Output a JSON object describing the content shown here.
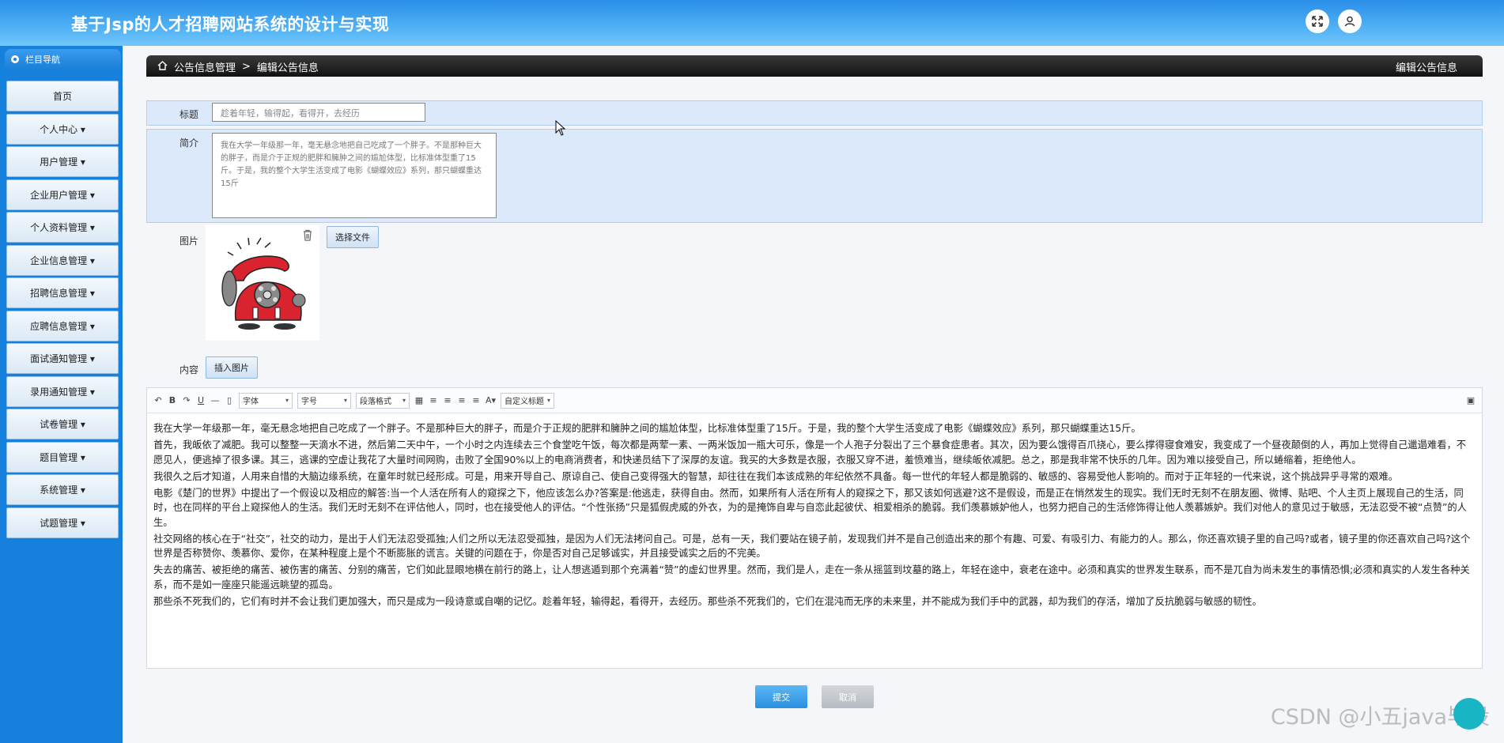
{
  "app": {
    "title": "基于Jsp的人才招聘网站系统的设计与实现"
  },
  "sidebar": {
    "header": "栏目导航",
    "items": [
      {
        "label": "首页"
      },
      {
        "label": "个人中心 ▾"
      },
      {
        "label": "用户管理 ▾"
      },
      {
        "label": "企业用户管理 ▾"
      },
      {
        "label": "个人资料管理 ▾"
      },
      {
        "label": "企业信息管理 ▾"
      },
      {
        "label": "招聘信息管理 ▾"
      },
      {
        "label": "应聘信息管理 ▾"
      },
      {
        "label": "面试通知管理 ▾"
      },
      {
        "label": "录用通知管理 ▾"
      },
      {
        "label": "试卷管理 ▾"
      },
      {
        "label": "题目管理 ▾"
      },
      {
        "label": "系统管理 ▾"
      },
      {
        "label": "试题管理 ▾"
      }
    ]
  },
  "breadcrumb": {
    "root": "公告信息管理",
    "sep": ">",
    "current": "编辑公告信息",
    "right_title": "编辑公告信息"
  },
  "form": {
    "title_label": "标题",
    "title_value": "趁着年轻，输得起，看得开，去经历",
    "intro_label": "简介",
    "intro_value": "我在大学一年级那一年，毫无悬念地把自己吃成了一个胖子。不是那种巨大的胖子，而是介于正规的肥胖和臃肿之间的尴尬体型，比标准体型重了15斤。于是，我的整个大学生活变成了电影《蝴蝶效应》系列，那只蝴蝶重达15斤",
    "image_label": "图片",
    "choose_file": "选择文件",
    "content_label": "内容",
    "insert_image": "插入图片"
  },
  "editor_toolbar": {
    "font": "字体",
    "size": "字号",
    "paragraph": "段落格式",
    "custom_title": "自定义标题"
  },
  "content": {
    "paragraphs": [
      "我在大学一年级那一年，毫无悬念地把自己吃成了一个胖子。不是那种巨大的胖子，而是介于正规的肥胖和臃肿之间的尴尬体型，比标准体型重了15斤。于是，我的整个大学生活变成了电影《蝴蝶效应》系列，那只蝴蝶重达15斤。",
      "首先，我皈依了减肥。我可以整整一天滴水不进，然后第二天中午，一个小时之内连续去三个食堂吃午饭，每次都是两荤一素、一两米饭加一瓶大可乐，像是一个人孢子分裂出了三个暴食症患者。其次，因为要么饿得百爪挠心，要么撑得寝食难安，我变成了一个昼夜颠倒的人，再加上觉得自己邋遢难看，不愿见人，便逃掉了很多课。其三，逃课的空虚让我花了大量时间网购，击败了全国90%以上的电商消费者，和快递员结下了深厚的友谊。我买的大多数是衣服，衣服又穿不进，羞愤难当，继续皈依减肥。总之，那是我非常不快乐的几年。因为难以接受自己，所以蜷缩着，拒绝他人。",
      "我很久之后才知道，人用来自惜的大脑边缘系统，在童年时就已经形成。可是，用来开导自己、原谅自己、使自己变得强大的智慧，却往往在我们本该成熟的年纪依然不具备。每一世代的年轻人都是脆弱的、敏感的、容易受他人影响的。而对于正年轻的一代来说，这个挑战异乎寻常的艰难。",
      "电影《楚门的世界》中提出了一个假设以及相应的解答:当一个人活在所有人的窥探之下，他应该怎么办?答案是:他逃走，获得自由。然而，如果所有人活在所有人的窥探之下，那又该如何逃避?这不是假设，而是正在悄然发生的现实。我们无时无刻不在朋友圈、微博、贴吧、个人主页上展现自己的生活，同时，也在同样的平台上窥探他人的生活。我们无时无刻不在评估他人，同时，也在接受他人的评估。“个性张扬”只是狐假虎威的外衣，为的是掩饰自卑与自恋此起彼伏、相爱相杀的脆弱。我们羡慕嫉妒他人，也努力把自己的生活修饰得让他人羡慕嫉妒。我们对他人的意见过于敏感，无法忍受不被“点赞”的人生。",
      "社交网络的核心在于“社交”，社交的动力，是出于人们无法忍受孤独;人们之所以无法忍受孤独，是因为人们无法拷问自己。可是，总有一天，我们要站在镜子前，发现我们并不是自己创造出来的那个有趣、可爱、有吸引力、有能力的人。那么，你还喜欢镜子里的自己吗?或者，镜子里的你还喜欢自己吗?这个世界是否称赞你、羡慕你、爱你，在某种程度上是个不断膨胀的谎言。关键的问题在于，你是否对自己足够诚实，并且接受诚实之后的不完美。",
      "失去的痛苦、被拒绝的痛苦、被伤害的痛苦、分别的痛苦，它们如此显眼地横在前行的路上，让人想逃遁到那个充满着“赞”的虚幻世界里。然而，我们是人，走在一条从摇篮到坟墓的路上，年轻在途中，衰老在途中。必须和真实的世界发生联系，而不是兀自为尚未发生的事情恐惧;必须和真实的人发生各种关系，而不是如一座座只能遥远眺望的孤岛。",
      "那些杀不死我们的，它们有时并不会让我们更加强大，而只是成为一段诗意或自嘲的记忆。趁着年轻，输得起，看得开，去经历。那些杀不死我们的，它们在混沌而无序的未来里，并不能成为我们手中的武器，却为我们的存活，增加了反抗脆弱与敏感的韧性。"
    ]
  },
  "actions": {
    "submit": "提交",
    "cancel": "取消"
  },
  "watermark": "CSDN @小五java毕设",
  "colors": {
    "topbar": "#2a8fe8",
    "sidebar": "#1681dd",
    "row_bg": "#dbe9fb",
    "submit": "#2a8fe0"
  }
}
